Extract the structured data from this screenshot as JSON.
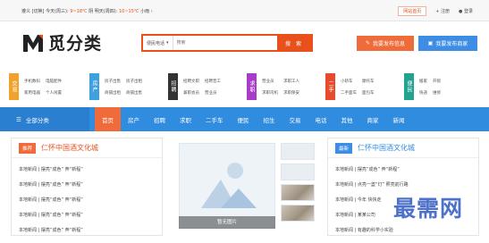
{
  "topbar": {
    "weather_prefix": "遵义 [切换]  今天(周三):",
    "weather_today": "9~18℃",
    "weather_mid": "阴  明天(周四):",
    "weather_tomorrow": "10~15℃",
    "weather_suffix": "小雨 ›",
    "home_link": "网站首页",
    "register": "注册",
    "login": "登录"
  },
  "header": {
    "logo_name": "觅分类",
    "search_category": "便民电话",
    "search_placeholder": "搜索",
    "search_button": "搜 索",
    "post_info_button": "我要发布信息",
    "post_shop_button": "我要发布商家",
    "colors": {
      "accent": "#e8501c",
      "blue": "#3d8de4"
    }
  },
  "categories": [
    {
      "badge": "交易",
      "color": "#f0a22a",
      "items": [
        "手机数码",
        "家用电器",
        "电脑配件",
        "个人闲置"
      ]
    },
    {
      "badge": "房产",
      "color": "#3fa0e0",
      "items": [
        "房子出售",
        "商铺出租",
        "房子出租",
        "商铺出售"
      ]
    },
    {
      "badge": "招聘",
      "color": "#333333",
      "items": [
        "招聘文职",
        "兼职会员",
        "招聘普工",
        "营业员"
      ]
    },
    {
      "badge": "求职",
      "color": "#a83bc7",
      "items": [
        "营业员",
        "求职司机",
        "求职工人",
        "求职保安"
      ]
    },
    {
      "badge": "二手",
      "color": "#e94a2c",
      "items": [
        "小轿车",
        "二手面车",
        "摩托车",
        "面包车"
      ]
    },
    {
      "badge": "便民",
      "color": "#22a38f",
      "items": [
        "搬家",
        "快递",
        "开锁",
        "维修"
      ]
    }
  ],
  "nav": {
    "all_categories": "全部分类",
    "items": [
      "首页",
      "房产",
      "招聘",
      "求职",
      "二手车",
      "便民",
      "招生",
      "交易",
      "电话",
      "其他",
      "商家",
      "新闻"
    ],
    "active_index": 0
  },
  "left_panel": {
    "tag": "推荐",
    "title": "仁怀中国酒文化城",
    "news": [
      "本地新闻 | 摆亮“成色” 奔“新程”",
      "本地新闻 | 摆亮“成色” 奔“新程”",
      "本地新闻 | 摆亮“成色” 奔“新程”",
      "本地新闻 | 摆亮“成色” 奔“新程”",
      "本地新闻 | 摆亮“成色” 奔“新程”"
    ]
  },
  "mid_panel": {
    "caption": "暂无图片"
  },
  "right_panel": {
    "tag": "最新",
    "title": "仁怀中国酒文化城",
    "news": [
      "本地新闻 | 摆亮“成色” 奔“新程”",
      "本地新闻 | 点亮一盏“灯” 照亮前行路",
      "本地新闻 | 今年 快快走",
      "本地新闻 | 某某公司",
      "本地新闻 | 有趣的科学小实验"
    ]
  },
  "watermark": "最需网"
}
